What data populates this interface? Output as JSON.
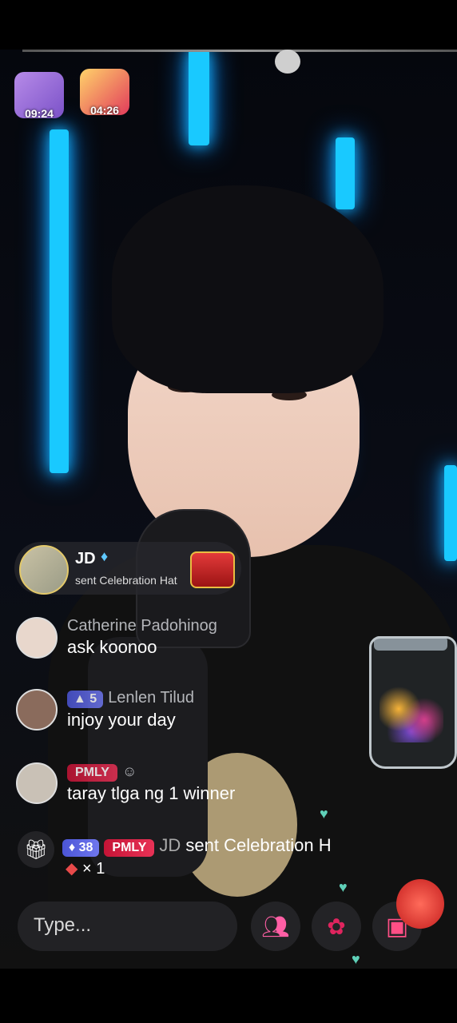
{
  "timers": {
    "left_badge": "09:24",
    "right_badge": "04:26"
  },
  "gift_notice": {
    "user": "JD",
    "message": "sent Celebration Hat"
  },
  "comments": [
    {
      "name": "Catherine Padohinog",
      "text": "ask koonoo"
    },
    {
      "level": "5",
      "name": "Lenlen Tilud",
      "text": "injoy your day"
    },
    {
      "fan_badge": "PMLY",
      "text": "taray tlga ng 1 winner"
    }
  ],
  "activity": {
    "level": "38",
    "fan_badge": "PMLY",
    "name": "JD",
    "message": "sent Celebration H",
    "count": "× 1"
  },
  "input": {
    "placeholder": "Type..."
  },
  "colors": {
    "neon": "#19c9ff",
    "level_badge": "#5560e0",
    "fan_badge": "#d41d42"
  },
  "icons": [
    "gift-icon",
    "users-icon",
    "rose-icon",
    "gift-box-icon",
    "diamond-icon",
    "heart-icon"
  ]
}
